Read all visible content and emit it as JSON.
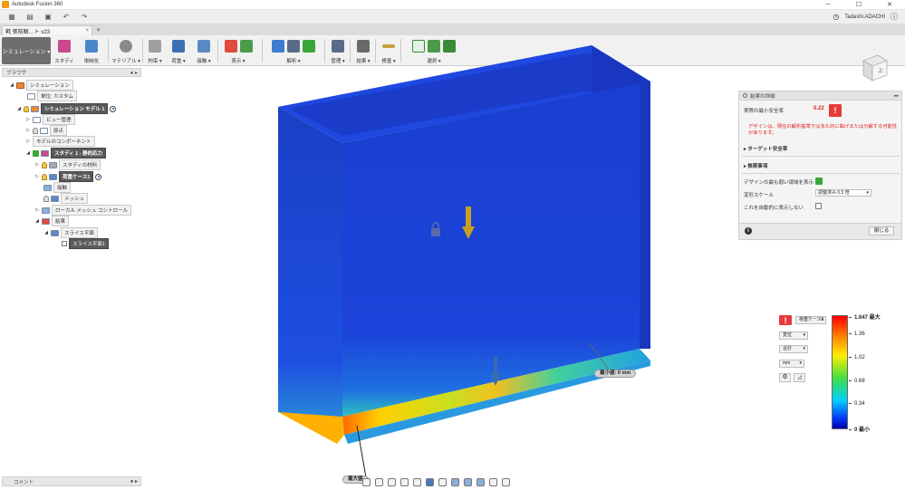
{
  "window": {
    "title": "Autodesk Fusion 360"
  },
  "qat": {
    "user": "Tadashi ADACHI",
    "controls": [
      "minimize",
      "maximize",
      "close"
    ]
  },
  "doc_tab": {
    "title": "㲰 張前解…ト v23",
    "close": "×",
    "add": "+"
  },
  "ribbon": {
    "workspace": "シミュレーション ▾",
    "groups": [
      {
        "label": "スタディ"
      },
      {
        "label": "単純化"
      },
      {
        "label": "マテリアル ▾"
      },
      {
        "label": "拘束 ▾"
      },
      {
        "label": "荷重 ▾"
      },
      {
        "label": "接触 ▾"
      },
      {
        "label": "表示 ▾"
      },
      {
        "label": "解析 ▾"
      },
      {
        "label": "管理 ▾"
      },
      {
        "label": "結果 ▾"
      },
      {
        "label": "検査 ▾"
      },
      {
        "label": "選択 ▾"
      }
    ]
  },
  "browser": {
    "title": "ブラウザ",
    "items": [
      {
        "label": "シミュレーション"
      },
      {
        "label": "単位: カスタム"
      },
      {
        "label": "シミュレーション モデル 1"
      },
      {
        "label": "ビュー管理"
      },
      {
        "label": "原点"
      },
      {
        "label": "モデルのコンポーネント"
      },
      {
        "label": "スタディ 1 - 静的応力"
      },
      {
        "label": "スタディの材料"
      },
      {
        "label": "荷重ケース1"
      },
      {
        "label": "接触"
      },
      {
        "label": "メッシュ"
      },
      {
        "label": "ローカル メッシュ コントロール"
      },
      {
        "label": "結果"
      },
      {
        "label": "スライス平面"
      },
      {
        "label": "スライス平面1"
      }
    ]
  },
  "comments": {
    "title": "コメント"
  },
  "results_panel": {
    "title": "結果の詳細",
    "min_sf_label": "実際の最小安全率",
    "min_sf_value": "0.22",
    "warning": "デザインは、現在の解析基準では永久的に曲げまたは分解する可能性があります。",
    "target_sf": "ターゲット安全率",
    "recommendations": "推奨事項",
    "show_weakest": "デザインの最も弱い領域を表示",
    "deform_scale_label": "変形スケール",
    "deform_scale_value": "調整済み 0.5 倍",
    "no_auto_show": "これを自動的に表示しない",
    "close": "閉じる"
  },
  "legend": {
    "result_type": "荷重ケース1",
    "quantity": "変位",
    "component": "合計",
    "unit": "mm",
    "max_label": "1.647 最大",
    "ticks": [
      "1.36",
      "1.02",
      "0.68",
      "0.34"
    ],
    "min_label": "0 最小"
  },
  "annotations": {
    "min_value": "最小値: 0 mm",
    "max_value": "最大値"
  },
  "colors": {
    "model_blue": "#1c4bd8",
    "warning_red": "#e02020",
    "workspace_btn": "#6e6e6e"
  }
}
